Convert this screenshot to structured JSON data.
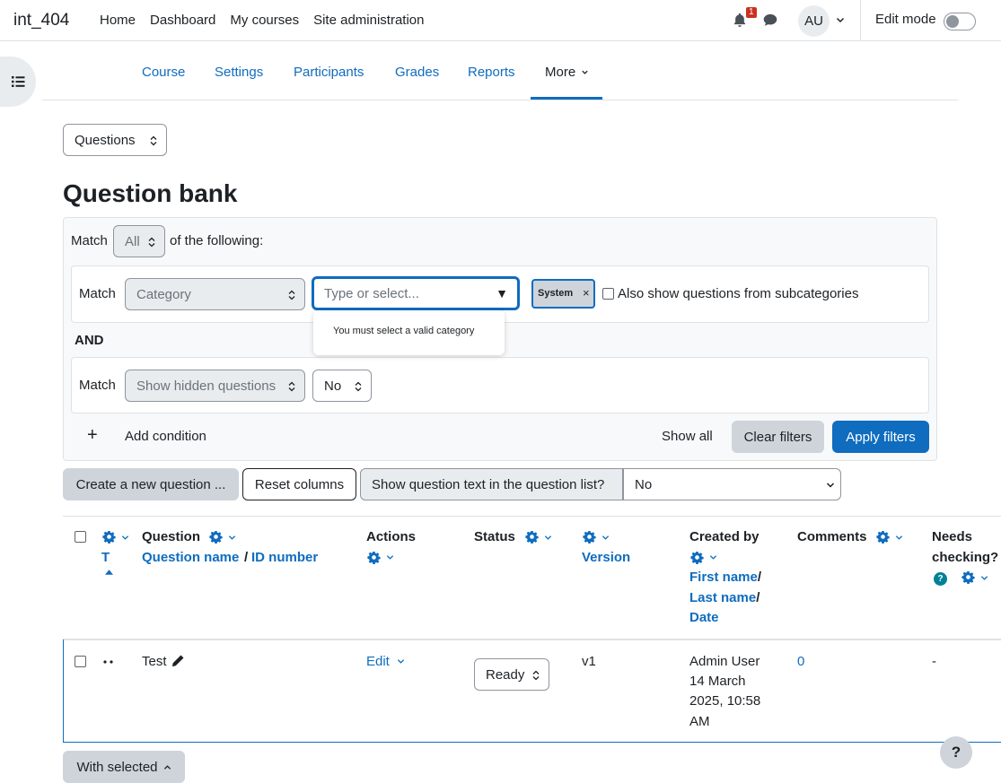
{
  "navbar": {
    "site_name": "int_404",
    "links": [
      "Home",
      "Dashboard",
      "My courses",
      "Site administration"
    ],
    "notification_count": "1",
    "avatar_initials": "AU",
    "edit_mode_label": "Edit mode"
  },
  "secondary_nav": {
    "items": [
      "Course",
      "Settings",
      "Participants",
      "Grades",
      "Reports"
    ],
    "more_label": "More"
  },
  "bank_select": "Questions",
  "page_title": "Question bank",
  "filters": {
    "match_label": "Match",
    "match_value": "All",
    "of_following": "of the following:",
    "condition1": {
      "match_label": "Match",
      "field": "Category",
      "input_placeholder": "Type or select...",
      "tag": "System",
      "tag_remove": "×",
      "subcategories_label": "Also show questions from subcategories",
      "tooltip": "You must select a valid category"
    },
    "join_label": "AND",
    "condition2": {
      "match_label": "Match",
      "field": "Show hidden questions",
      "value": "No"
    },
    "add_condition_icon": "+",
    "add_condition": "Add condition",
    "show_all": "Show all",
    "clear_filters": "Clear filters",
    "apply_filters": "Apply filters"
  },
  "actions": {
    "create_question": "Create a new question ...",
    "reset_columns": "Reset columns",
    "show_text_label": "Show question text in the question list?",
    "show_text_value": "No"
  },
  "table": {
    "headers": {
      "type_sort": "T",
      "question": "Question",
      "question_name": "Question name",
      "slash": "/",
      "id_number": "ID number",
      "actions": "Actions",
      "status": "Status",
      "version": "Version",
      "created_by": "Created by",
      "first_name": "First name",
      "last_name": "Last name",
      "date": "Date",
      "comments": "Comments",
      "needs_checking": "Needs",
      "needs_checking2": "checking?"
    },
    "rows": [
      {
        "name": "Test",
        "action": "Edit",
        "status": "Ready",
        "version": "v1",
        "created_by": [
          "Admin User",
          "14 March",
          "2025, 10:58",
          "AM"
        ],
        "comments": "0",
        "needs_checking": "-"
      }
    ]
  },
  "with_selected": "With selected",
  "help_label": "?",
  "colors": {
    "primary": "#0f6cbf",
    "secondary": "#ced4da",
    "badge": "#ca3120"
  }
}
